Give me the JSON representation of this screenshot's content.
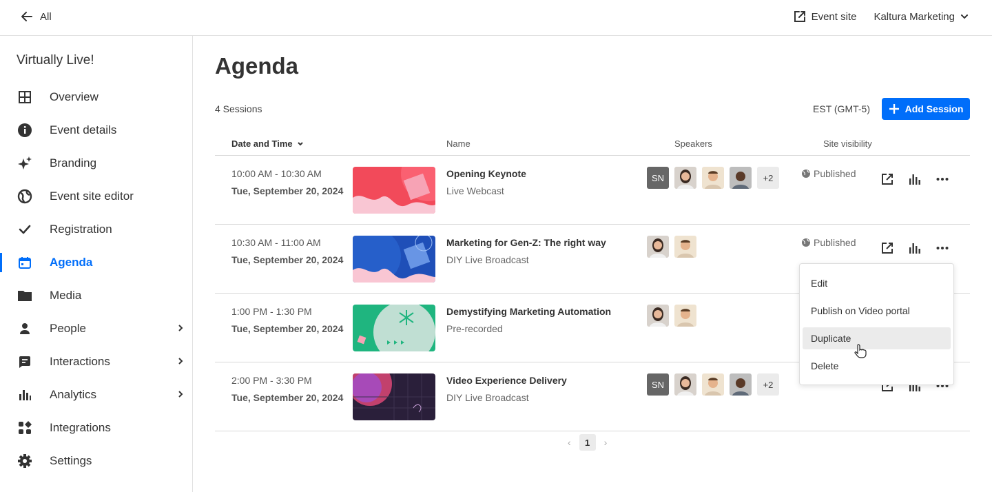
{
  "topbar": {
    "back_label": "All",
    "event_site_label": "Event site",
    "account_label": "Kaltura Marketing"
  },
  "sidebar": {
    "event_title": "Virtually Live!",
    "items": [
      {
        "label": "Overview",
        "icon": "grid-icon"
      },
      {
        "label": "Event details",
        "icon": "info-icon"
      },
      {
        "label": "Branding",
        "icon": "sparkle-icon"
      },
      {
        "label": "Event site editor",
        "icon": "globe-icon"
      },
      {
        "label": "Registration",
        "icon": "check-icon"
      },
      {
        "label": "Agenda",
        "icon": "calendar-icon",
        "active": true
      },
      {
        "label": "Media",
        "icon": "folder-icon"
      },
      {
        "label": "People",
        "icon": "person-icon",
        "expandable": true
      },
      {
        "label": "Interactions",
        "icon": "chat-icon",
        "expandable": true
      },
      {
        "label": "Analytics",
        "icon": "bar-chart-icon",
        "expandable": true
      },
      {
        "label": "Integrations",
        "icon": "integrations-icon"
      },
      {
        "label": "Settings",
        "icon": "gear-icon"
      }
    ]
  },
  "main": {
    "title": "Agenda",
    "session_count": "4 Sessions",
    "timezone": "EST (GMT-5)",
    "add_session_label": "Add Session",
    "columns": {
      "date": "Date and Time",
      "name": "Name",
      "speakers": "Speakers",
      "visibility": "Site visibility"
    },
    "sessions": [
      {
        "time": "10:00 AM - 10:30 AM",
        "date": "Tue, September 20, 2024",
        "name": "Opening Keynote",
        "type": "Live Webcast",
        "initials": "SN",
        "more": "+2",
        "visibility": "Published"
      },
      {
        "time": "10:30 AM - 11:00 AM",
        "date": "Tue, September 20, 2024",
        "name": "Marketing for Gen-Z: The right way",
        "type": "DIY Live Broadcast",
        "visibility": "Published"
      },
      {
        "time": "1:00 PM - 1:30 PM",
        "date": "Tue, September 20, 2024",
        "name": "Demystifying Marketing Automation",
        "type": "Pre-recorded"
      },
      {
        "time": "2:00 PM - 3:30 PM",
        "date": "Tue, September 20, 2024",
        "name": "Video Experience Delivery",
        "type": "DIY Live Broadcast",
        "initials": "SN",
        "more": "+2"
      }
    ],
    "pagination": {
      "current": "1"
    }
  },
  "menu": {
    "items": [
      "Edit",
      "Publish on Video portal",
      "Duplicate",
      "Delete"
    ],
    "hovered": "Duplicate"
  },
  "colors": {
    "accent": "#006efa"
  }
}
